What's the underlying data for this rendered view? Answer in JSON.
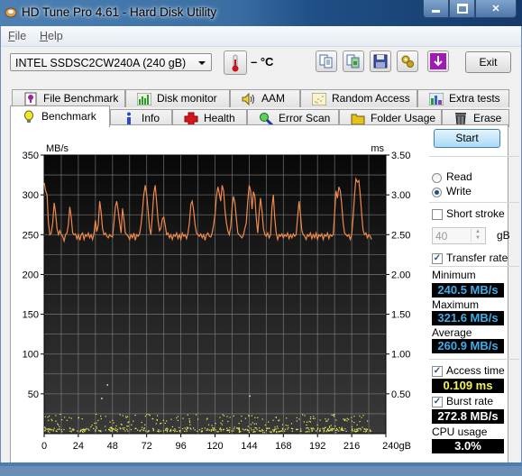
{
  "window": {
    "title": "HD Tune Pro 4.61 - Hard Disk Utility",
    "controls": {
      "minimize": "minimize-icon",
      "maximize": "maximize-icon",
      "close": "close-icon"
    }
  },
  "menu": [
    {
      "label": "File",
      "accel": "F"
    },
    {
      "label": "Help",
      "accel": "H"
    }
  ],
  "toolbar": {
    "drive": "INTEL SSDSC2CW240A (240 gB)",
    "temperature": "– °C",
    "buttons": [
      {
        "name": "copy-text",
        "icon": "copy-text-icon"
      },
      {
        "name": "copy-screenshot",
        "icon": "copy-screenshot-icon"
      },
      {
        "name": "save",
        "icon": "floppy-disk-icon"
      },
      {
        "name": "options",
        "icon": "gears-icon"
      },
      {
        "name": "download",
        "icon": "down-arrow-icon"
      }
    ],
    "exit_label": "Exit"
  },
  "tabs": {
    "top_row": [
      {
        "label": "File Benchmark",
        "icon": "file-benchmark-icon"
      },
      {
        "label": "Disk monitor",
        "icon": "disk-monitor-icon"
      },
      {
        "label": "AAM",
        "icon": "speaker-icon"
      },
      {
        "label": "Random Access",
        "icon": "random-access-icon"
      },
      {
        "label": "Extra tests",
        "icon": "extra-tests-icon"
      }
    ],
    "bottom_row": [
      {
        "label": "Benchmark",
        "icon": "lightbulb-icon",
        "active": true
      },
      {
        "label": "Info",
        "icon": "info-icon"
      },
      {
        "label": "Health",
        "icon": "health-cross-icon"
      },
      {
        "label": "Error Scan",
        "icon": "magnifier-icon"
      },
      {
        "label": "Folder Usage",
        "icon": "folder-icon"
      },
      {
        "label": "Erase",
        "icon": "trash-icon"
      }
    ]
  },
  "side": {
    "start_label": "Start",
    "read_label": "Read",
    "write_label": "Write",
    "mode": "Write",
    "short_stroke_label": "Short stroke",
    "short_stroke_checked": false,
    "short_stroke_value": "40",
    "short_stroke_unit": "gB",
    "transfer_rate_label": "Transfer rate",
    "transfer_rate_checked": true,
    "minimum_label": "Minimum",
    "minimum_value": "240.5 MB/s",
    "maximum_label": "Maximum",
    "maximum_value": "321.6 MB/s",
    "average_label": "Average",
    "average_value": "260.9 MB/s",
    "access_time_label": "Access time",
    "access_time_checked": true,
    "access_time_value": "0.109 ms",
    "burst_rate_label": "Burst rate",
    "burst_rate_checked": true,
    "burst_rate_value": "272.8 MB/s",
    "cpu_label": "CPU usage",
    "cpu_value": "3.0%"
  },
  "colors": {
    "transfer_line": "#f08a4b",
    "access_points": "#f0f060",
    "readout_blue": "#3daee9",
    "readout_yellow": "#f5f25a"
  },
  "chart_data": {
    "type": "line",
    "title": "",
    "xlabel": "gB",
    "ylabel_left": "MB/s",
    "ylabel_right": "ms",
    "x_ticks": [
      "0",
      "24",
      "48",
      "72",
      "96",
      "120",
      "144",
      "168",
      "192",
      "216",
      "240gB"
    ],
    "y_left_ticks": [
      "50",
      "100",
      "150",
      "200",
      "250",
      "300",
      "350"
    ],
    "y_right_ticks": [
      "0.50",
      "1.00",
      "1.50",
      "2.00",
      "2.50",
      "3.00",
      "3.50"
    ],
    "xlim": [
      0,
      240
    ],
    "ylim_left": [
      0,
      350
    ],
    "ylim_right": [
      0,
      3.5
    ],
    "grid": true,
    "series": [
      {
        "name": "Transfer rate (MB/s)",
        "kind": "line",
        "points": [
          [
            0,
            315
          ],
          [
            1,
            305
          ],
          [
            2,
            300
          ],
          [
            3,
            265
          ],
          [
            4,
            250
          ],
          [
            5,
            252
          ],
          [
            6,
            265
          ],
          [
            7,
            290
          ],
          [
            8,
            278
          ],
          [
            9,
            258
          ],
          [
            10,
            250
          ],
          [
            11,
            255
          ],
          [
            12,
            250
          ],
          [
            13,
            248
          ],
          [
            14,
            242
          ],
          [
            15,
            250
          ],
          [
            16,
            252
          ],
          [
            17,
            262
          ],
          [
            18,
            285
          ],
          [
            19,
            272
          ],
          [
            20,
            252
          ],
          [
            21,
            250
          ],
          [
            22,
            251
          ],
          [
            23,
            245
          ],
          [
            24,
            250
          ],
          [
            25,
            243
          ],
          [
            26,
            250
          ],
          [
            27,
            252
          ],
          [
            28,
            244
          ],
          [
            29,
            250
          ],
          [
            30,
            248
          ],
          [
            31,
            252
          ],
          [
            32,
            246
          ],
          [
            33,
            250
          ],
          [
            34,
            244
          ],
          [
            35,
            252
          ],
          [
            36,
            268
          ],
          [
            37,
            254
          ],
          [
            38,
            262
          ],
          [
            39,
            292
          ],
          [
            40,
            278
          ],
          [
            41,
            258
          ],
          [
            42,
            250
          ],
          [
            43,
            252
          ],
          [
            44,
            248
          ],
          [
            45,
            246
          ],
          [
            46,
            250
          ],
          [
            47,
            248
          ],
          [
            48,
            247
          ],
          [
            49,
            265
          ],
          [
            50,
            285
          ],
          [
            51,
            292
          ],
          [
            52,
            280
          ],
          [
            53,
            265
          ],
          [
            54,
            252
          ],
          [
            55,
            283
          ],
          [
            56,
            270
          ],
          [
            57,
            252
          ],
          [
            58,
            250
          ],
          [
            59,
            248
          ],
          [
            60,
            244
          ],
          [
            61,
            250
          ],
          [
            62,
            246
          ],
          [
            63,
            252
          ],
          [
            64,
            243
          ],
          [
            65,
            250
          ],
          [
            66,
            248
          ],
          [
            67,
            251
          ],
          [
            68,
            262
          ],
          [
            69,
            280
          ],
          [
            70,
            300
          ],
          [
            71,
            312
          ],
          [
            72,
            300
          ],
          [
            73,
            280
          ],
          [
            74,
            258
          ],
          [
            75,
            250
          ],
          [
            76,
            275
          ],
          [
            77,
            302
          ],
          [
            78,
            312
          ],
          [
            79,
            290
          ],
          [
            80,
            268
          ],
          [
            81,
            255
          ],
          [
            82,
            258
          ],
          [
            83,
            270
          ],
          [
            84,
            272
          ],
          [
            85,
            262
          ],
          [
            86,
            250
          ],
          [
            87,
            252
          ],
          [
            88,
            246
          ],
          [
            89,
            250
          ],
          [
            90,
            244
          ],
          [
            91,
            250
          ],
          [
            92,
            248
          ],
          [
            93,
            252
          ],
          [
            94,
            245
          ],
          [
            95,
            250
          ],
          [
            96,
            244
          ],
          [
            97,
            252
          ],
          [
            98,
            248
          ],
          [
            99,
            250
          ],
          [
            100,
            245
          ],
          [
            101,
            252
          ],
          [
            102,
            265
          ],
          [
            103,
            288
          ],
          [
            104,
            292
          ],
          [
            105,
            280
          ],
          [
            106,
            262
          ],
          [
            107,
            252
          ],
          [
            108,
            250
          ],
          [
            109,
            248
          ],
          [
            110,
            251
          ],
          [
            111,
            246
          ],
          [
            112,
            250
          ],
          [
            113,
            243
          ],
          [
            114,
            250
          ],
          [
            115,
            252
          ],
          [
            116,
            248
          ],
          [
            117,
            247
          ],
          [
            118,
            252
          ],
          [
            119,
            262
          ],
          [
            120,
            275
          ],
          [
            121,
            298
          ],
          [
            122,
            310
          ],
          [
            123,
            302
          ],
          [
            124,
            292
          ],
          [
            125,
            312
          ],
          [
            126,
            305
          ],
          [
            127,
            280
          ],
          [
            128,
            265
          ],
          [
            129,
            255
          ],
          [
            130,
            250
          ],
          [
            131,
            260
          ],
          [
            132,
            285
          ],
          [
            133,
            298
          ],
          [
            134,
            290
          ],
          [
            135,
            270
          ],
          [
            136,
            252
          ],
          [
            137,
            250
          ],
          [
            138,
            248
          ],
          [
            139,
            246
          ],
          [
            140,
            250
          ],
          [
            141,
            258
          ],
          [
            142,
            265
          ],
          [
            143,
            292
          ],
          [
            144,
            312
          ],
          [
            145,
            305
          ],
          [
            146,
            282
          ],
          [
            147,
            304
          ],
          [
            148,
            298
          ],
          [
            149,
            270
          ],
          [
            150,
            252
          ],
          [
            151,
            278
          ],
          [
            152,
            296
          ],
          [
            153,
            280
          ],
          [
            154,
            258
          ],
          [
            155,
            250
          ],
          [
            156,
            248
          ],
          [
            157,
            252
          ],
          [
            158,
            246
          ],
          [
            159,
            250
          ],
          [
            160,
            285
          ],
          [
            161,
            300
          ],
          [
            162,
            270
          ],
          [
            163,
            252
          ],
          [
            164,
            244
          ],
          [
            165,
            250
          ],
          [
            166,
            248
          ],
          [
            167,
            251
          ],
          [
            168,
            246
          ],
          [
            169,
            250
          ],
          [
            170,
            248
          ],
          [
            171,
            252
          ],
          [
            172,
            245
          ],
          [
            173,
            250
          ],
          [
            174,
            246
          ],
          [
            175,
            251
          ],
          [
            176,
            248
          ],
          [
            177,
            250
          ],
          [
            178,
            272
          ],
          [
            179,
            292
          ],
          [
            180,
            275
          ],
          [
            181,
            255
          ],
          [
            182,
            250
          ],
          [
            183,
            248
          ],
          [
            184,
            244
          ],
          [
            185,
            250
          ],
          [
            186,
            248
          ],
          [
            187,
            252
          ],
          [
            188,
            245
          ],
          [
            189,
            250
          ],
          [
            190,
            246
          ],
          [
            191,
            252
          ],
          [
            192,
            244
          ],
          [
            193,
            250
          ],
          [
            194,
            248
          ],
          [
            195,
            251
          ],
          [
            196,
            244
          ],
          [
            197,
            250
          ],
          [
            198,
            248
          ],
          [
            199,
            252
          ],
          [
            200,
            245
          ],
          [
            201,
            250
          ],
          [
            202,
            248
          ],
          [
            203,
            250
          ],
          [
            204,
            275
          ],
          [
            205,
            305
          ],
          [
            206,
            296
          ],
          [
            207,
            310
          ],
          [
            208,
            305
          ],
          [
            209,
            288
          ],
          [
            210,
            265
          ],
          [
            211,
            252
          ],
          [
            212,
            250
          ],
          [
            213,
            248
          ],
          [
            214,
            250
          ],
          [
            215,
            244
          ],
          [
            216,
            250
          ],
          [
            217,
            272
          ],
          [
            218,
            300
          ],
          [
            219,
            320
          ],
          [
            220,
            316
          ],
          [
            221,
            318
          ],
          [
            222,
            300
          ],
          [
            223,
            275
          ],
          [
            224,
            256
          ],
          [
            225,
            250
          ],
          [
            226,
            252
          ],
          [
            227,
            246
          ],
          [
            228,
            250
          ],
          [
            229,
            248
          ],
          [
            230,
            244
          ]
        ]
      },
      {
        "name": "Access time (ms)",
        "kind": "scatter",
        "note": "dense band of points between approx 0.02 and 0.25 ms across 0–230 gB, with outliers near 0.6 ms (x≈44) and 0.45 ms (x≈144)",
        "outliers": [
          [
            44,
            0.62
          ],
          [
            40,
            0.45
          ],
          [
            144,
            0.48
          ]
        ],
        "band_ms": [
          0.02,
          0.25
        ],
        "average_ms": 0.109
      }
    ]
  }
}
